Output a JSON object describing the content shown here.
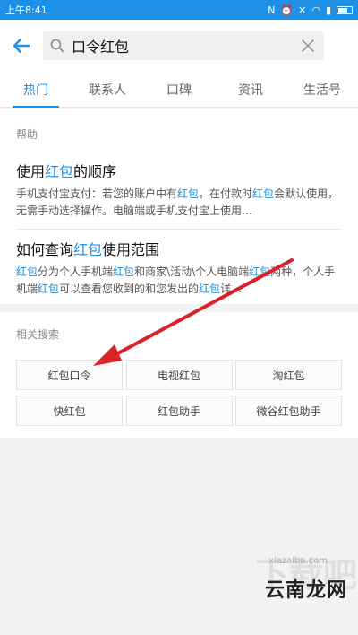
{
  "status_bar": {
    "time": "上午8:41"
  },
  "header": {
    "query": "口令红包"
  },
  "tabs": [
    {
      "label": "热门",
      "active": true
    },
    {
      "label": "联系人",
      "active": false
    },
    {
      "label": "口碑",
      "active": false
    },
    {
      "label": "资讯",
      "active": false
    },
    {
      "label": "生活号",
      "active": false
    }
  ],
  "help": {
    "label": "帮助",
    "results": [
      {
        "title_parts": [
          "使用",
          "红包",
          "的顺序"
        ],
        "desc_parts": [
          "手机支付宝支付：若您的账户中有",
          "红包",
          "，在付款时",
          "红包",
          "会默认使用，无需手动选择操作。电脑端或手机支付宝上使用…"
        ]
      },
      {
        "title_parts": [
          "如何查询",
          "红包",
          "使用范围"
        ],
        "desc_parts": [
          "红包",
          "分为个人手机端",
          "红包",
          "和商家\\活动\\个人电脑端",
          "红包",
          "两种，个人手机端",
          "红包",
          "可以查看您收到的和您发出的",
          "红包",
          "详…"
        ]
      }
    ]
  },
  "related": {
    "label": "相关搜索",
    "chips": [
      "红包口令",
      "电视红包",
      "淘红包",
      "快红包",
      "红包助手",
      "微谷红包助手"
    ]
  },
  "watermark": {
    "cn": "云南龙网",
    "en": "xiazaiba.com",
    "bg": "下载吧"
  },
  "colors": {
    "accent": "#1e90e6",
    "arrow": "#d9232a"
  }
}
